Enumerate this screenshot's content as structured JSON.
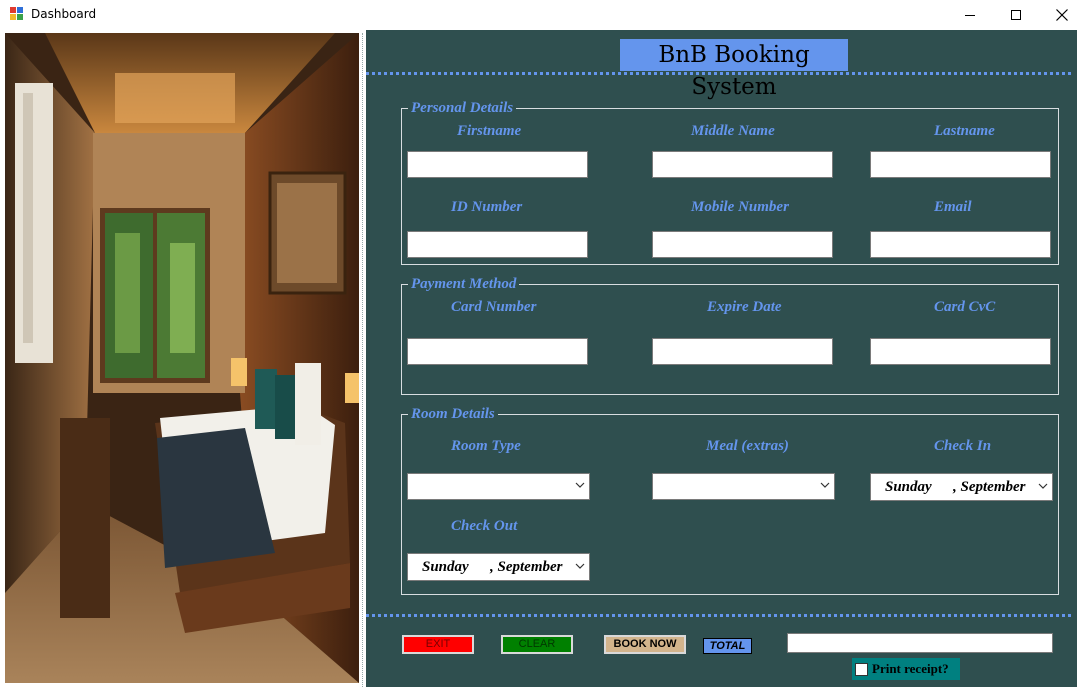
{
  "window": {
    "title": "Dashboard"
  },
  "app": {
    "title": "BnB Booking System"
  },
  "personal": {
    "legend": "Personal Details",
    "firstname_label": "Firstname",
    "middlename_label": "Middle Name",
    "lastname_label": "Lastname",
    "id_label": "ID Number",
    "mobile_label": "Mobile Number",
    "email_label": "Email",
    "firstname": "",
    "middlename": "",
    "lastname": "",
    "id_number": "",
    "mobile": "",
    "email": ""
  },
  "payment": {
    "legend": "Payment Method",
    "card_number_label": "Card Number",
    "expire_label": "Expire Date",
    "cvc_label": "Card CvC",
    "card_number": "",
    "expire": "",
    "cvc": ""
  },
  "room": {
    "legend": "Room Details",
    "room_type_label": "Room Type",
    "meal_label": "Meal (extras)",
    "checkin_label": "Check In",
    "checkout_label": "Check Out",
    "room_type": "",
    "meal": "",
    "checkin": {
      "day": "Sunday",
      "month": ", September"
    },
    "checkout": {
      "day": "Sunday",
      "month": ", September"
    }
  },
  "actions": {
    "exit_label": "EXIT",
    "clear_label": "CLEAR",
    "book_label": "BOOK NOW",
    "total_label": "TOTAL",
    "total_value": "",
    "receipt_label": "Print receipt?",
    "receipt_checked": false
  },
  "colors": {
    "panel_bg": "#2f4f4f",
    "accent": "#6495ed",
    "exit": "#ff0000",
    "clear": "#008000",
    "book": "#d2b48c",
    "receipt_bg": "#008080"
  },
  "icons": [
    "app-icon",
    "minimize-icon",
    "maximize-icon",
    "close-icon",
    "chevron-down-icon",
    "room-photo"
  ]
}
